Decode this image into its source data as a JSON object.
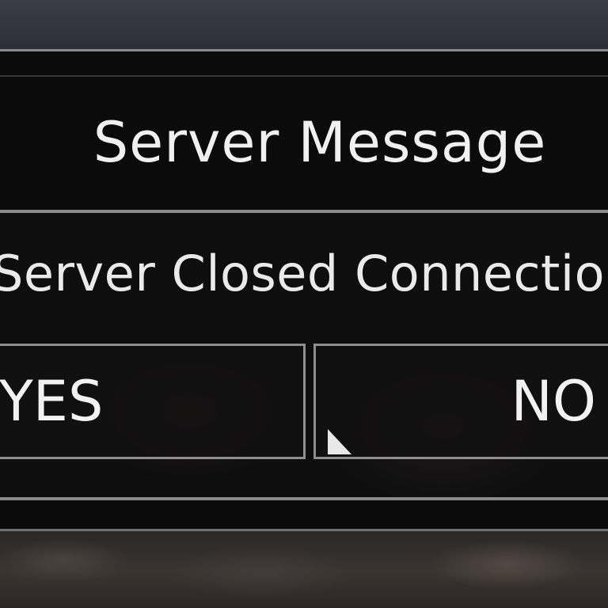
{
  "dialog": {
    "title": "Server Message",
    "message": "Server Closed Connection",
    "yes_label": "YES",
    "no_label": "NO"
  },
  "colors": {
    "panel_bg": "#0b0b0b",
    "border": "#8d8d8d",
    "text": "#f0f0f0"
  },
  "icons": {
    "cursor": "mouse-pointer-icon"
  }
}
